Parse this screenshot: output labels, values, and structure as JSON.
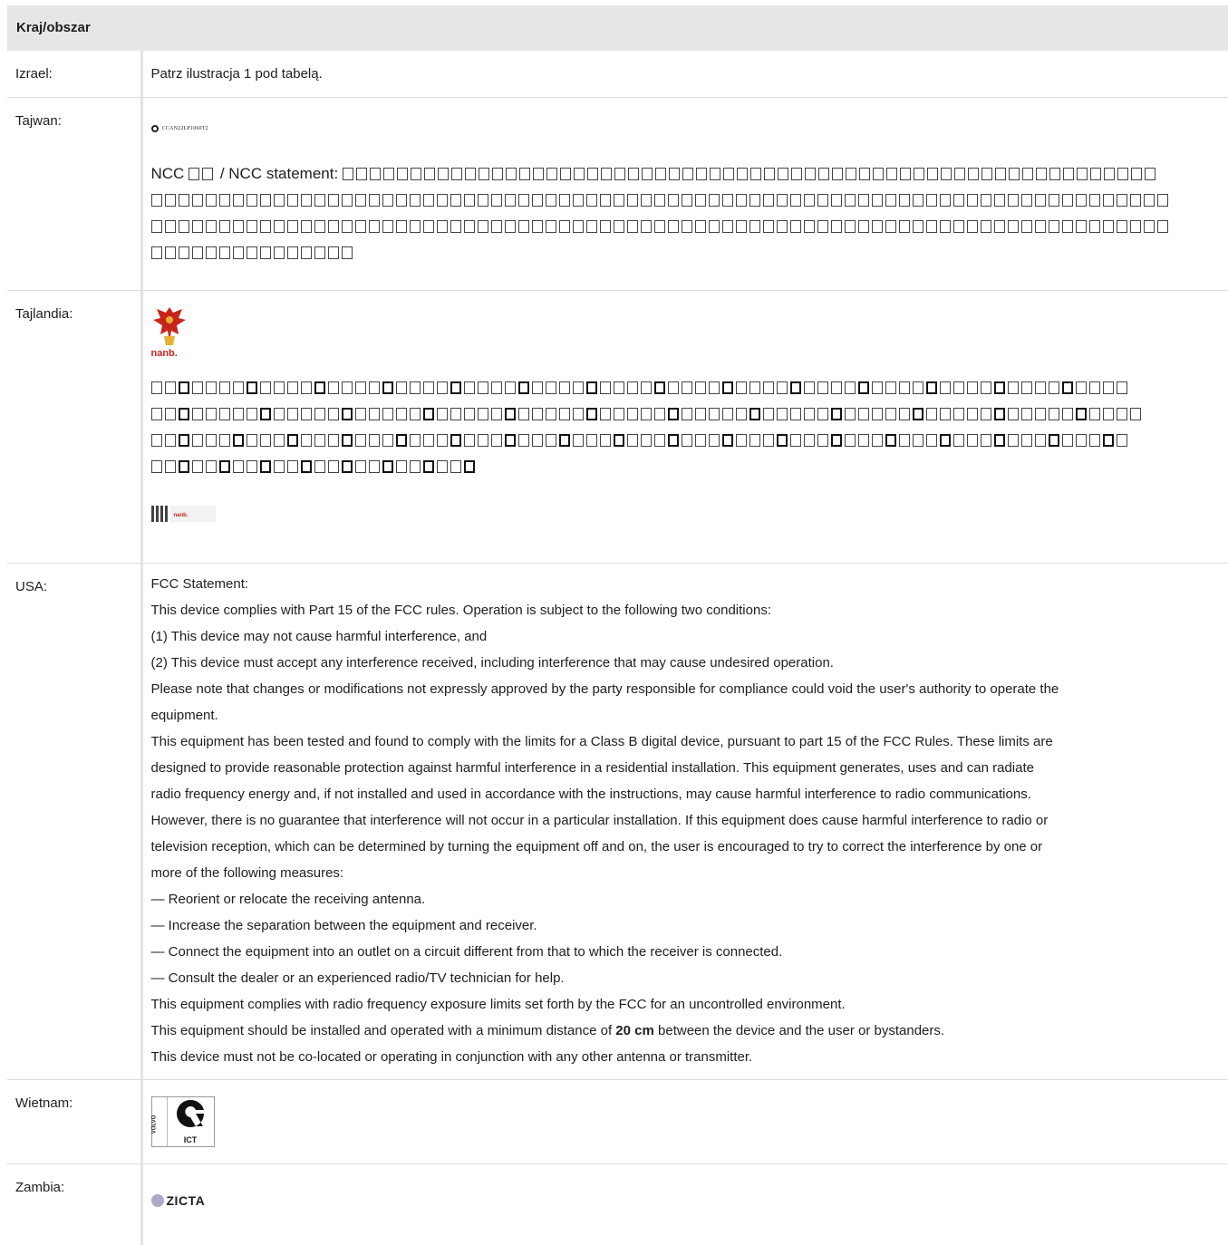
{
  "header": {
    "title": "Kraj/obszar"
  },
  "rows": {
    "israel": {
      "country": "Izrael:",
      "text": "Patrz ilustracja 1 pod tabelą."
    },
    "taiwan": {
      "country": "Tajwan:",
      "label_code": "CCAN22LP1060T2",
      "ncc_prefix": "NCC",
      "ncc_statement": "/ NCC statement:"
    },
    "thailand": {
      "country": "Tajlandia:",
      "logo_text": "nanb.",
      "label_text": "nanb."
    },
    "usa": {
      "country": "USA:",
      "lines": [
        "FCC Statement:",
        "This device complies with Part 15 of the FCC rules. Operation is subject to the following two conditions:",
        "(1) This device may not cause harmful interference, and",
        "(2) This device must accept any interference received, including interference that may cause undesired operation.",
        "Please note that changes or modifications not expressly approved by the party responsible for compliance could void the user's authority to operate the",
        "equipment.",
        "This equipment has been tested and found to comply with the limits for a Class B digital device, pursuant to part 15 of the FCC Rules. These limits are",
        "designed to provide reasonable protection against harmful interference in a residential installation. This equipment generates, uses and can radiate",
        "radio frequency energy and, if not installed and used in accordance with the instructions, may cause harmful interference to radio communications.",
        "However, there is no guarantee that interference will not occur in a particular installation. If this equipment does cause harmful interference to radio or",
        "television reception, which can be determined by turning the equipment off and on, the user is encouraged to try to correct the interference by one or",
        "more of the following measures:",
        "— Reorient or relocate the receiving antenna.",
        "— Increase the separation between the equipment and receiver.",
        "— Connect the equipment into an outlet on a circuit different from that to which the receiver is connected.",
        "— Consult the dealer or an experienced radio/TV technician for help.",
        "This equipment complies with radio frequency exposure limits set forth by the FCC for an uncontrolled environment."
      ],
      "distance_pre": "This equipment should be installed and operated with a minimum distance of",
      "distance_value": "20 cm",
      "distance_post": "between the device and the user or bystanders.",
      "last_line": "This device must not be co-located or operating in conjunction with any other antenna or transmitter."
    },
    "vietnam": {
      "country": "Wietnam:",
      "mark_text": "ICT",
      "side_text": "VOLVO"
    },
    "zambia": {
      "country": "Zambia:",
      "logo_text": "ZICTA"
    }
  }
}
